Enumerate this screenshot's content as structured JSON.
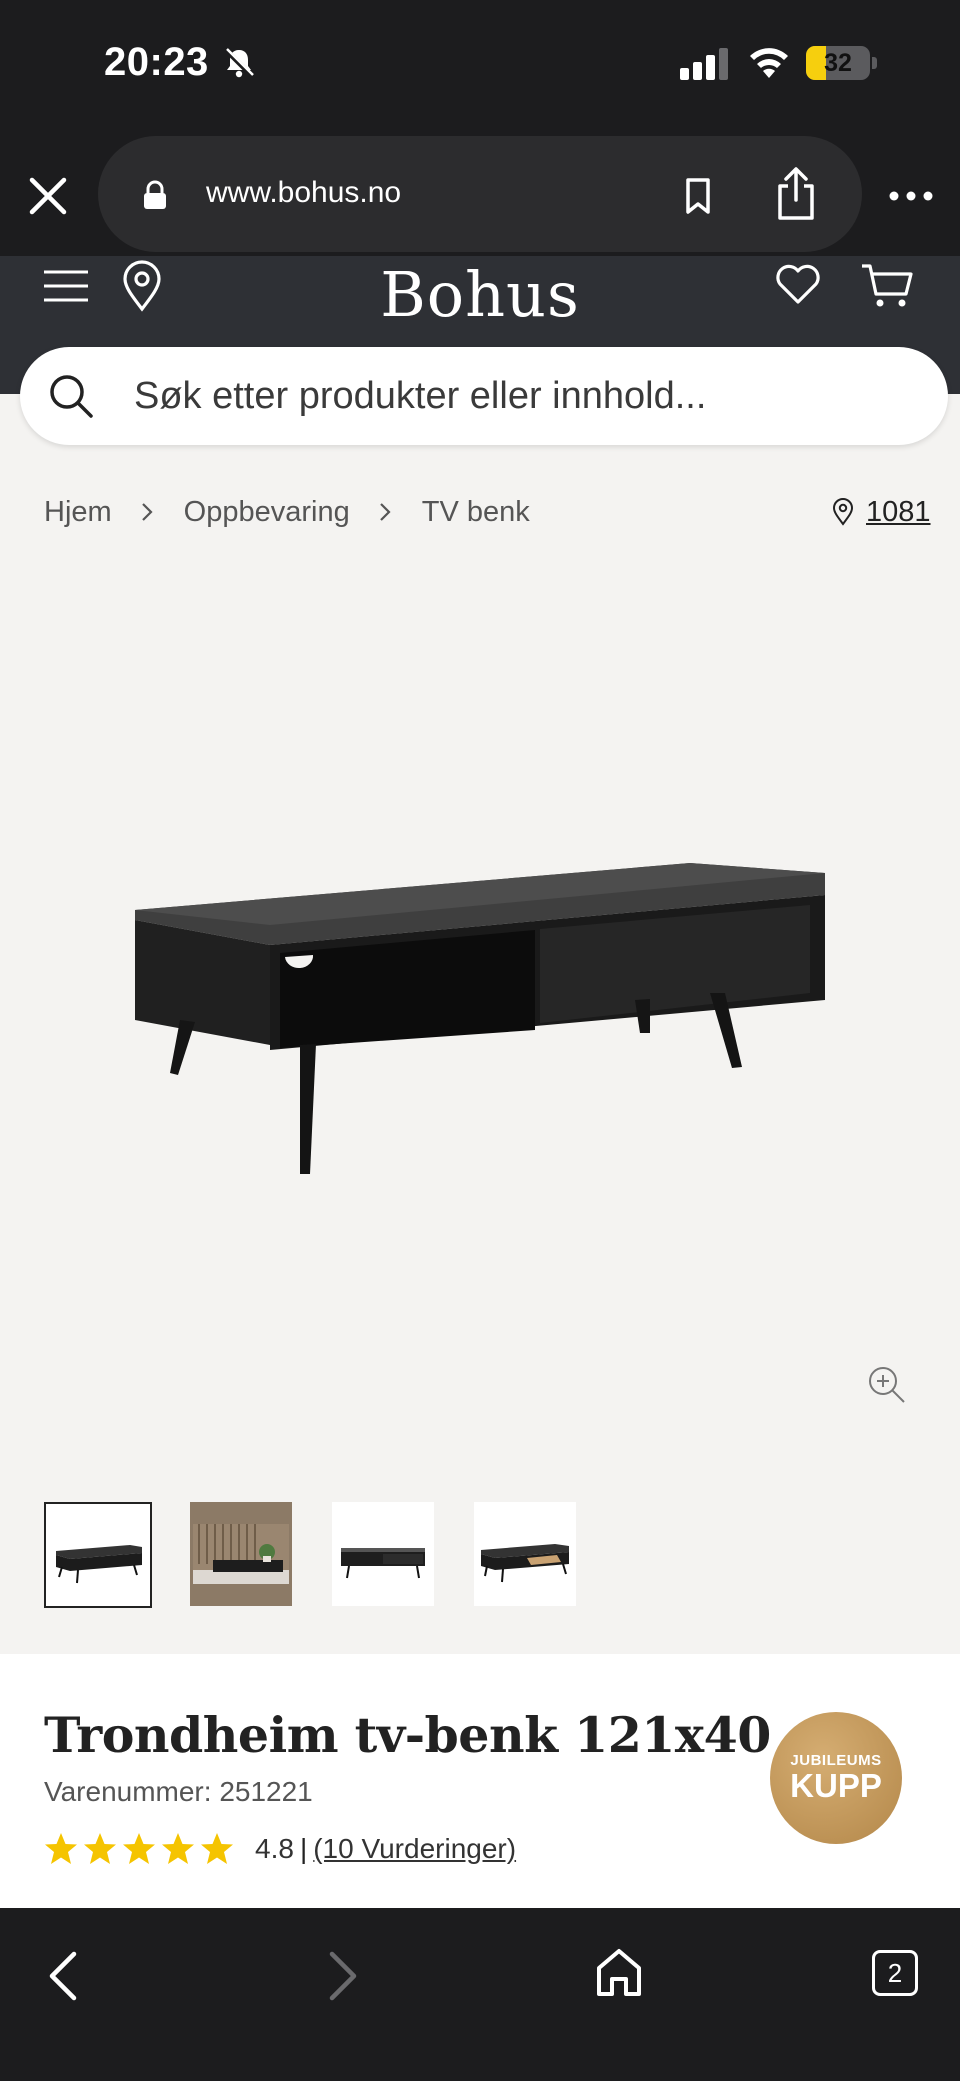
{
  "status_bar": {
    "time": "20:23",
    "battery_percent": "32",
    "battery_level": 0.32,
    "icons": [
      "bell-slash-icon",
      "signal-icon",
      "wifi-icon",
      "battery-icon"
    ]
  },
  "browser": {
    "url": "www.bohus.no",
    "icons": [
      "close-icon",
      "lock-icon",
      "bookmark-icon",
      "share-icon",
      "more-icon"
    ]
  },
  "header": {
    "brand": "Bohus",
    "icons": [
      "menu-icon",
      "location-pin-icon",
      "heart-icon",
      "cart-icon"
    ]
  },
  "search": {
    "placeholder": "Søk etter produkter eller innhold..."
  },
  "breadcrumb": {
    "items": [
      "Hjem",
      "Oppbevaring",
      "TV benk"
    ],
    "postcode": "1081"
  },
  "gallery": {
    "thumbnails": 4,
    "active_index": 0
  },
  "product": {
    "title": "Trondheim tv-benk 121x40",
    "sku_label": "Varenummer: 251221",
    "rating_score": "4.8",
    "rating_value": 4.8,
    "rating_stars": 5,
    "rating_separator": "|",
    "rating_count": "(10 Vurderinger)",
    "badge_top": "JUBILEUMS",
    "badge_main": "KUPP"
  },
  "toolbar": {
    "tab_count": "2"
  },
  "colors": {
    "chrome": "#1c1c1e",
    "header": "#2e3035",
    "page_bg": "#f4f3f1",
    "star": "#f5c400",
    "badge": "#c49a5c",
    "battery": "#f6cf0e"
  }
}
